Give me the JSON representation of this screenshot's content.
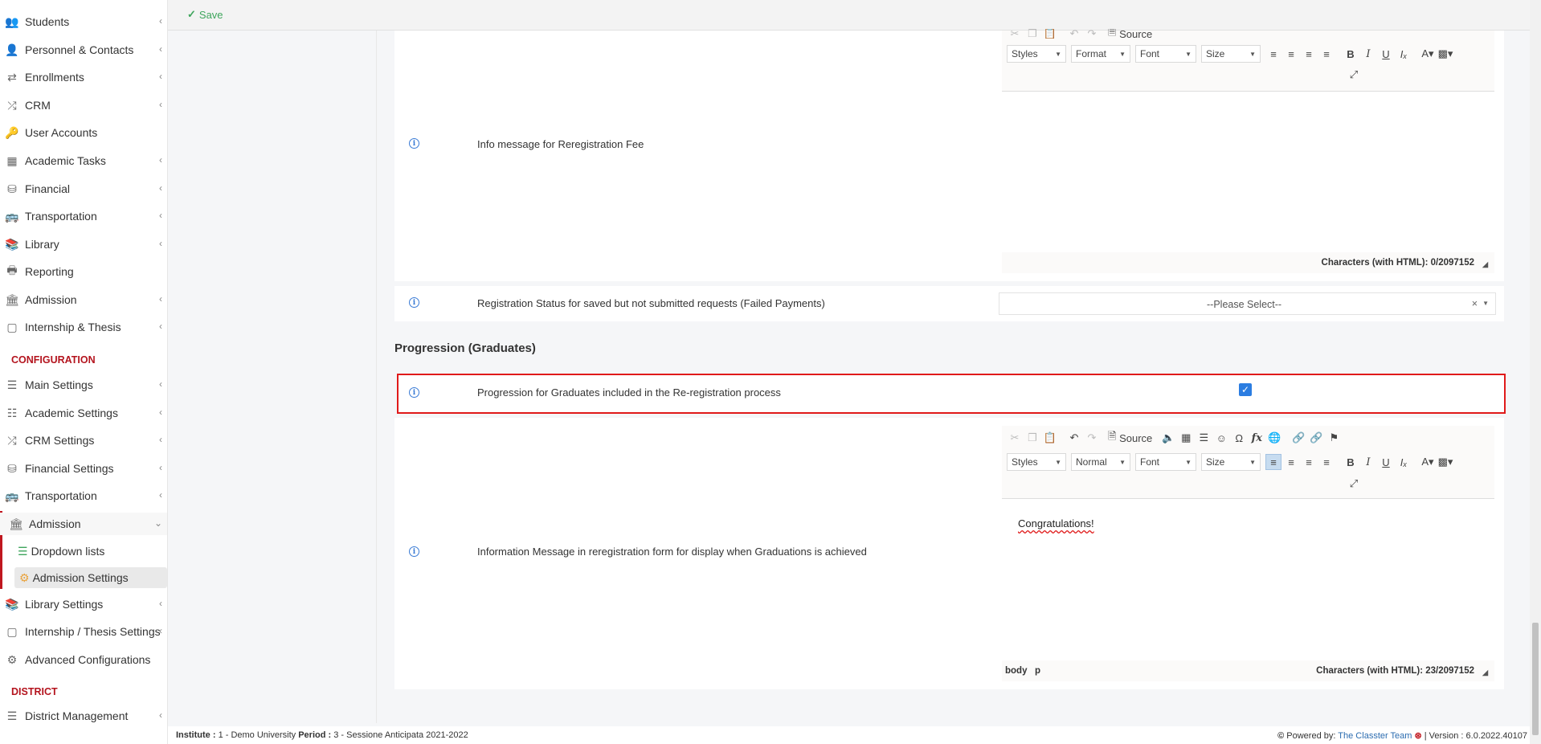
{
  "sidebar": {
    "items": [
      {
        "label": "Students",
        "icon": "users-icon",
        "chevron": "‹"
      },
      {
        "label": "Personnel & Contacts",
        "icon": "contacts-icon",
        "chevron": "‹"
      },
      {
        "label": "Enrollments",
        "icon": "exchange-icon",
        "chevron": "‹"
      },
      {
        "label": "CRM",
        "icon": "shuffle-icon",
        "chevron": "‹"
      },
      {
        "label": "User Accounts",
        "icon": "key-icon",
        "chevron": ""
      },
      {
        "label": "Academic Tasks",
        "icon": "grid-icon",
        "chevron": "‹"
      },
      {
        "label": "Financial",
        "icon": "coins-icon",
        "chevron": "‹"
      },
      {
        "label": "Transportation",
        "icon": "bus-icon",
        "chevron": "‹"
      },
      {
        "label": "Library",
        "icon": "books-icon",
        "chevron": "‹"
      },
      {
        "label": "Reporting",
        "icon": "print-icon",
        "chevron": ""
      },
      {
        "label": "Admission",
        "icon": "bank-icon",
        "chevron": "‹"
      },
      {
        "label": "Internship & Thesis",
        "icon": "cube-icon",
        "chevron": "‹"
      }
    ],
    "config_title": "CONFIGURATION",
    "config_items": [
      {
        "label": "Main Settings",
        "icon": "sliders-icon",
        "chevron": "‹"
      },
      {
        "label": "Academic Settings",
        "icon": "sitemap-icon",
        "chevron": "‹"
      },
      {
        "label": "CRM Settings",
        "icon": "shuffle-icon",
        "chevron": "‹"
      },
      {
        "label": "Financial Settings",
        "icon": "coins-icon",
        "chevron": "‹"
      },
      {
        "label": "Transportation",
        "icon": "bus-icon",
        "chevron": "‹"
      }
    ],
    "admission_active": {
      "label": "Admission",
      "icon": "bank-icon",
      "chevron": "⌄"
    },
    "sub_items": [
      {
        "label": "Dropdown lists",
        "icon": "layers-icon"
      },
      {
        "label": "Admission Settings",
        "icon": "gear-icon"
      }
    ],
    "config_items_2": [
      {
        "label": "Library Settings",
        "icon": "books-icon",
        "chevron": "‹"
      },
      {
        "label": "Internship / Thesis Settings",
        "icon": "cube-icon",
        "chevron": "‹"
      },
      {
        "label": "Advanced Configurations",
        "icon": "gears-icon",
        "chevron": ""
      }
    ],
    "district_title": "DISTRICT",
    "district_items": [
      {
        "label": "District Management",
        "icon": "list-icon",
        "chevron": "‹"
      }
    ]
  },
  "topbar": {
    "save_label": "Save"
  },
  "rows": {
    "reg_fee_label": "Info message for Reregistration Fee",
    "reg_status_label": "Registration Status for saved but not submitted requests (Failed Payments)",
    "select_placeholder": "--Please Select--",
    "select_clear": "×",
    "progression_section": "Progression (Graduates)",
    "progression_label": "Progression for Graduates included in the Re-registration process",
    "info_message_label": "Information Message in reregistration form for display when Graduations is achieved"
  },
  "editor1": {
    "source_label": "Source",
    "styles_label": "Styles",
    "format_label": "Format",
    "font_label": "Font",
    "size_label": "Size",
    "char_count": "Characters (with HTML): 0/2097152"
  },
  "editor2": {
    "source_label": "Source",
    "styles_label": "Styles",
    "format_label": "Normal",
    "font_label": "Font",
    "size_label": "Size",
    "content": "Congratulations!",
    "path_body": "body",
    "path_p": "p",
    "char_count": "Characters (with HTML): 23/2097152"
  },
  "statusbar": {
    "institute_label": "Institute :",
    "institute_value": "1 - Demo University",
    "period_label": "Period :",
    "period_value": "3 - Sessione Anticipata 2021-2022",
    "powered_by": "Powered by:",
    "team": "The Classter Team",
    "version": "| Version : 6.0.2022.40107"
  },
  "colors": {
    "accent": "#c0171f",
    "save": "#3ea55c",
    "check": "#2b7de1",
    "highlight": "#e01a1a"
  }
}
